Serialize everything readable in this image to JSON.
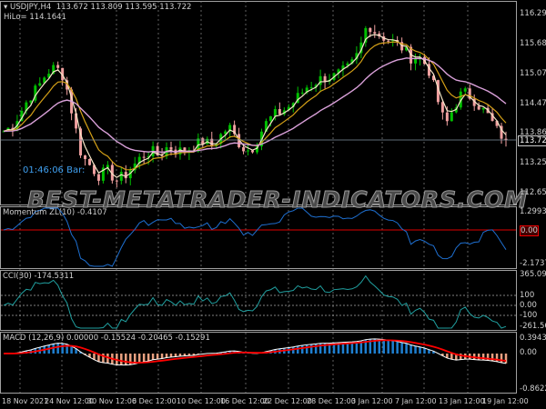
{
  "header": {
    "symbol": "USDJPY,H4",
    "ohlc": "113.672 113.809 113.595 113.722",
    "hilo": "HiLo= 114.1641"
  },
  "timer": "01:46:06 Bar:",
  "watermark": "BEST-METATRADER-INDICATORS.COM",
  "price_axis": [
    "116.290",
    "115.680",
    "115.070",
    "114.470",
    "113.860",
    "113.250",
    "112.650"
  ],
  "current_price": "113.722",
  "momentum": {
    "label": "Momentum ZL(10) -0.4107",
    "axis": [
      "1.2993",
      "0.00",
      "-2.1737"
    ]
  },
  "cci": {
    "label": "CCI(30) -174.5311",
    "axis": [
      "365.0915",
      "100",
      "0.00",
      "-100",
      "-261.5676"
    ]
  },
  "macd": {
    "label": "MACD (12,26,9) 0.00000 -0.15524 -0.20465 -0.15291",
    "axis": [
      "0.39433",
      "0.00",
      "-0.86228"
    ]
  },
  "time_axis": [
    "18 Nov 2021",
    "24 Nov 12:00",
    "30 Nov 12:00",
    "6 Dec 12:00",
    "10 Dec 12:00",
    "16 Dec 12:00",
    "22 Dec 12:00",
    "28 Dec 12:00",
    "3 Jan 12:00",
    "7 Jan 12:00",
    "13 Jan 12:00",
    "19 Jan 12:00"
  ],
  "colors": {
    "bull": "#00c000",
    "bear": "#f0a0a0",
    "ma_fast": "#f5e6c8",
    "ma_mid": "#d4a017",
    "ma_slow": "#d9a0d9",
    "momentum": "#1e6fd0",
    "cci": "#20a0a0",
    "zero": "#e00000",
    "hist_up": "#1e7fd0",
    "hist_dn": "#e8a080",
    "macd": "#ffffff",
    "signal": "#ff0000"
  },
  "chart_data": {
    "type": "candlestick",
    "closes": [
      113.9,
      114.0,
      114.3,
      114.6,
      114.8,
      115.1,
      115.2,
      115.0,
      114.2,
      113.4,
      113.2,
      113.0,
      113.1,
      112.9,
      113.0,
      113.2,
      113.4,
      113.5,
      113.4,
      113.6,
      113.5,
      113.5,
      113.6,
      113.7,
      113.6,
      113.8,
      114.0,
      113.7,
      113.5,
      113.6,
      114.0,
      114.2,
      114.3,
      114.4,
      114.6,
      114.8,
      114.9,
      115.0,
      115.0,
      115.1,
      115.2,
      115.5,
      116.1,
      115.9,
      115.8,
      115.7,
      115.6,
      115.4,
      115.4,
      115.2,
      114.6,
      114.0,
      114.4,
      114.7,
      114.6,
      114.4,
      114.2,
      113.9,
      113.72
    ],
    "ylim": [
      112.65,
      116.29
    ]
  }
}
